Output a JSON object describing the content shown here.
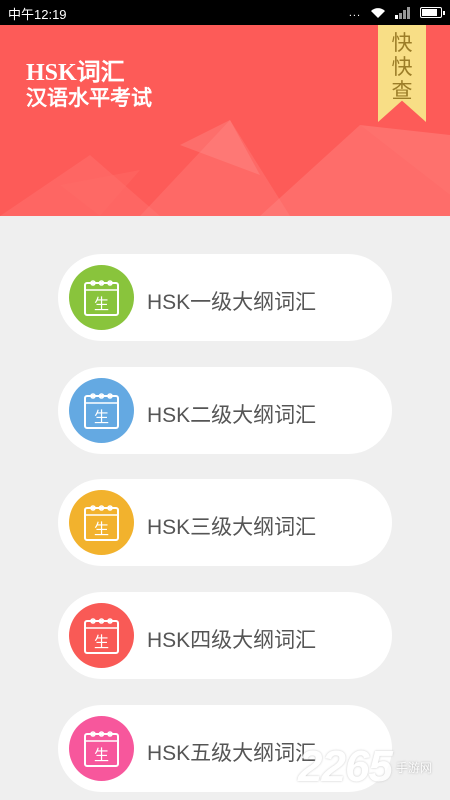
{
  "status_bar": {
    "time": "中午12:19",
    "dots": "..."
  },
  "header": {
    "title_line1": "HSK词汇",
    "title_line2": "汉语水平考试",
    "bookmark_chars": [
      "快",
      "快",
      "查"
    ]
  },
  "menu": [
    {
      "label": "HSK一级大纲词汇",
      "icon_text": "生",
      "color": "#89c43c"
    },
    {
      "label": "HSK二级大纲词汇",
      "icon_text": "生",
      "color": "#64a9e2"
    },
    {
      "label": "HSK三级大纲词汇",
      "icon_text": "生",
      "color": "#f2b22d"
    },
    {
      "label": "HSK四级大纲词汇",
      "icon_text": "生",
      "color": "#f95a56"
    },
    {
      "label": "HSK五级大纲词汇",
      "icon_text": "生",
      "color": "#f7579c"
    }
  ],
  "watermark": {
    "number": "2265",
    "suffix": "手游网"
  }
}
